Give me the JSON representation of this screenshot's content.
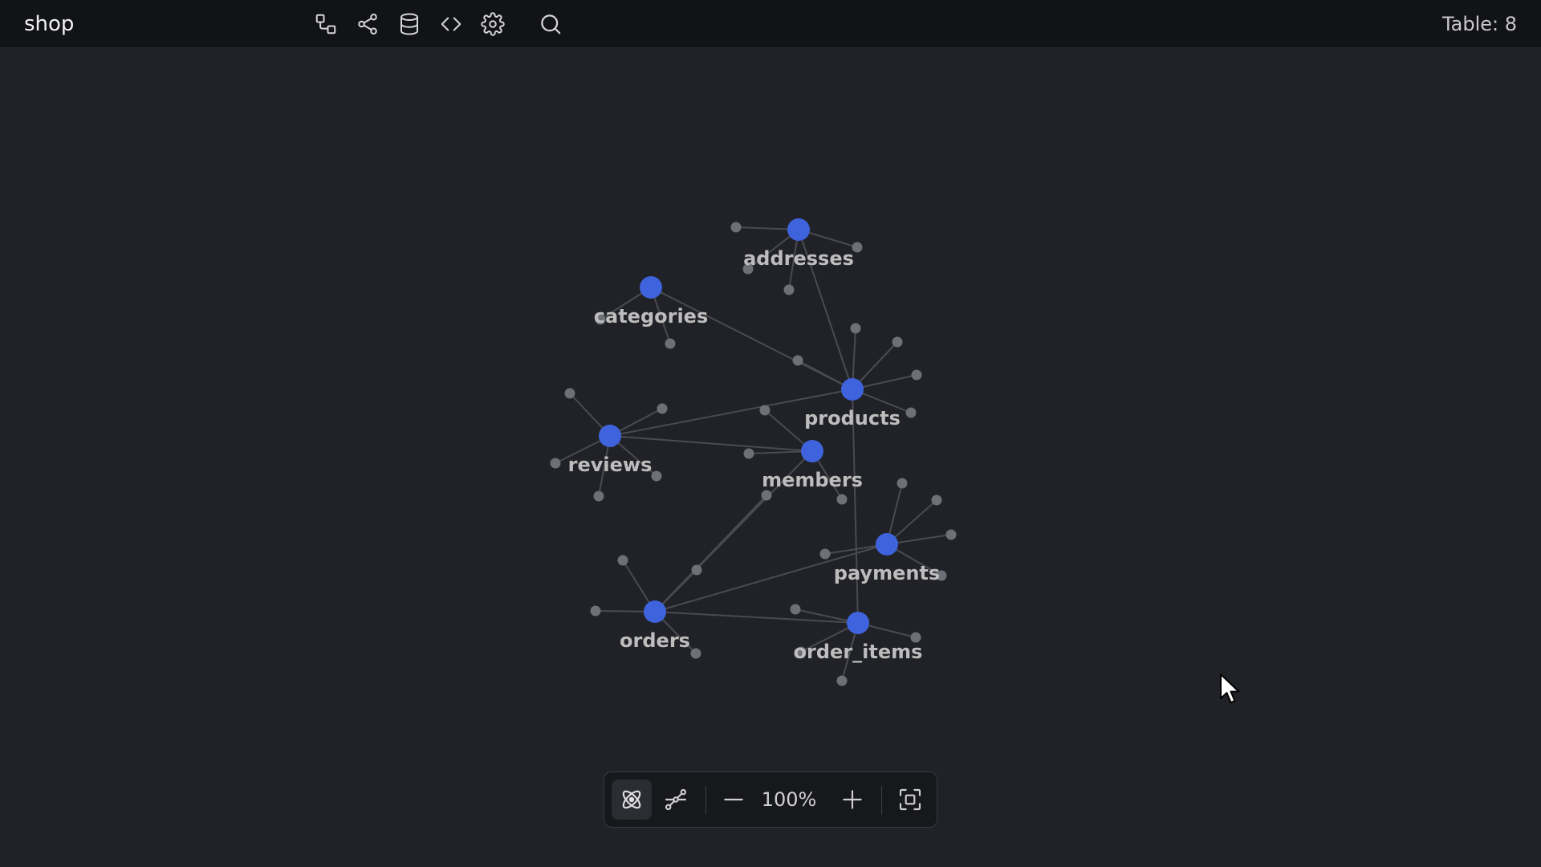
{
  "header": {
    "title": "shop",
    "table_count": "Table: 8",
    "tools": [
      {
        "name": "diagram-icon"
      },
      {
        "name": "share-icon"
      },
      {
        "name": "database-icon"
      },
      {
        "name": "code-icon"
      },
      {
        "name": "settings-icon"
      },
      {
        "name": "search-icon"
      }
    ]
  },
  "graph": {
    "tables": [
      "addresses",
      "categories",
      "products",
      "reviews",
      "members",
      "payments",
      "orders",
      "order_items"
    ],
    "relations": [
      [
        "addresses",
        "products"
      ],
      [
        "categories",
        "products"
      ],
      [
        "reviews",
        "products"
      ],
      [
        "reviews",
        "members"
      ],
      [
        "products",
        "order_items"
      ],
      [
        "orders",
        "members"
      ],
      [
        "orders",
        "payments"
      ],
      [
        "orders",
        "order_items"
      ]
    ],
    "colors": {
      "table_node": "#3e63dd",
      "field_node": "#6e7077",
      "edge": "#4a4b50",
      "label": "#bdbdbd"
    }
  },
  "zoombar": {
    "zoom_level": "100%",
    "buttons": [
      "force-layout-icon",
      "tree-layout-icon",
      "zoom-out-icon",
      "zoom-in-icon",
      "fit-view-icon"
    ]
  }
}
